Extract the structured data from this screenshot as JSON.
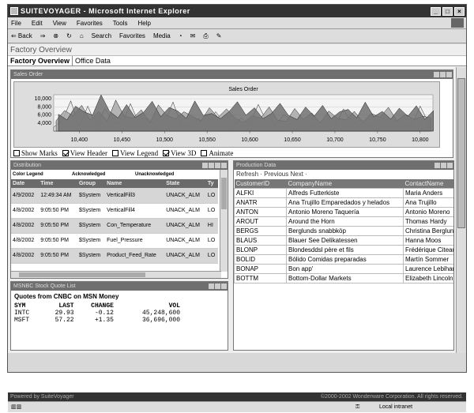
{
  "window": {
    "title": "SUITEVOYAGER - Microsoft Internet Explorer"
  },
  "menu": [
    "File",
    "Edit",
    "View",
    "Favorites",
    "Tools",
    "Help"
  ],
  "toolbar": {
    "back": "⇐ Back",
    "search": "Search",
    "favorites": "Favorites",
    "media": "Media"
  },
  "app": {
    "title": "Factory Overview",
    "tabs": [
      "Factory Overview",
      "Office Data"
    ]
  },
  "sales": {
    "panel_title": "Sales Order",
    "options": [
      {
        "label": "Show Marks",
        "checked": false
      },
      {
        "label": "View Header",
        "checked": true
      },
      {
        "label": "View Legend",
        "checked": false
      },
      {
        "label": "View 3D",
        "checked": true
      },
      {
        "label": "Animate",
        "checked": false
      }
    ]
  },
  "chart_data": {
    "type": "area",
    "title": "Sales Order",
    "xlabel": "",
    "ylabel": "",
    "xlim": [
      10370,
      10815
    ],
    "ylim": [
      2000,
      11000
    ],
    "x_ticks": [
      "10,400",
      "10,450",
      "10,500",
      "10,550",
      "10,600",
      "10,650",
      "10,700",
      "10,750",
      "10,800"
    ],
    "y_ticks": [
      "10,000",
      "8,000",
      "6,000",
      "4,000"
    ],
    "x": [
      10370,
      10380,
      10390,
      10400,
      10410,
      10420,
      10430,
      10440,
      10450,
      10460,
      10470,
      10480,
      10490,
      10500,
      10510,
      10520,
      10530,
      10540,
      10550,
      10560,
      10570,
      10580,
      10590,
      10600,
      10610,
      10620,
      10630,
      10640,
      10650,
      10660,
      10670,
      10680,
      10690,
      10700,
      10710,
      10720,
      10730,
      10740,
      10750,
      10760,
      10770,
      10780,
      10790,
      10800,
      10810
    ],
    "series": [
      {
        "values": [
          3000,
          4500,
          9500,
          3200,
          8200,
          3100,
          7600,
          4200,
          3600,
          8800,
          3900,
          5200,
          3100,
          4100,
          9200,
          3300,
          3500,
          5100,
          3200,
          6800,
          4000,
          3100,
          5300,
          3500,
          8600,
          4300,
          3200,
          6100,
          4500,
          3000,
          3300,
          3800,
          4400,
          3100,
          7500,
          3600,
          4800,
          3200,
          3900,
          3400,
          4700,
          3600,
          3300,
          8200,
          3900
        ]
      },
      {
        "values": [
          4000,
          6500,
          5200,
          7800,
          4100,
          6300,
          3900,
          9100,
          5100,
          4600,
          6700,
          3400,
          7900,
          5300,
          4400,
          6200,
          5100,
          3900,
          7200,
          4800,
          6900,
          4700,
          3500,
          5200,
          4600,
          7400,
          4100,
          3800,
          7000,
          4300,
          5900,
          3500,
          6400,
          4600,
          4200,
          6300,
          3700,
          5800,
          4800,
          7300,
          4000,
          5600,
          4300,
          5100,
          4700
        ]
      },
      {
        "values": [
          5000,
          3600,
          7000,
          5600,
          4800,
          9800,
          5700,
          4100,
          7400,
          4200,
          5500,
          8200,
          4400,
          6700,
          5800,
          4000,
          8300,
          4700,
          5200,
          3900,
          5600,
          8100,
          4800,
          6600,
          3900,
          5200,
          7700,
          4700,
          3700,
          6800,
          4500,
          7200,
          3900,
          5600,
          6200,
          4100,
          8000,
          4400,
          5700,
          3800,
          6500,
          4500,
          7100,
          3700,
          5900
        ]
      }
    ]
  },
  "distribution": {
    "panel_title": "Distribution",
    "legend": [
      "Color Legend",
      "Acknowledged",
      "Unacknowledged"
    ],
    "columns": [
      "Date",
      "Time",
      "Group",
      "Name",
      "State",
      "Ty"
    ],
    "rows": [
      [
        "4/9/2002",
        "12:49:34 AM",
        "$System",
        "VerticalFill3",
        "UNACK_ALM",
        "LO"
      ],
      [
        "4/8/2002",
        "9:05:50 PM",
        "$System",
        "VerticalFill4",
        "UNACK_ALM",
        "LO"
      ],
      [
        "4/8/2002",
        "9:05:50 PM",
        "$System",
        "Con_Temperature",
        "UNACK_ALM",
        "HI"
      ],
      [
        "4/8/2002",
        "9:05:50 PM",
        "$System",
        "Fuel_Pressure",
        "UNACK_ALM",
        "LO"
      ],
      [
        "4/8/2002",
        "9:05:50 PM",
        "$System",
        "Product_Feed_Rate",
        "UNACK_ALM",
        "LO"
      ]
    ]
  },
  "stock": {
    "panel_title": "MSNBC Stock Quote List",
    "heading": "Quotes from CNBC on MSN Money",
    "columns": [
      "SYM",
      "LAST",
      "CHANGE",
      "VOL"
    ],
    "rows": [
      [
        "INTC",
        "29.93",
        "-0.12",
        "45,248,600"
      ],
      [
        "MSFT",
        "57.22",
        "+1.35",
        "36,696,000"
      ]
    ]
  },
  "production": {
    "panel_title": "Production Data",
    "nav": {
      "refresh": "Refresh",
      "previous": "Previous",
      "next": "Next"
    },
    "columns": [
      "CustomerID",
      "CompanyName",
      "ContactName"
    ],
    "rows": [
      [
        "ALFKI",
        "Alfreds Futterkiste",
        "Maria Anders"
      ],
      [
        "ANATR",
        "Ana Trujillo Emparedados y helados",
        "Ana Trujillo"
      ],
      [
        "ANTON",
        "Antonio Moreno Taquería",
        "Antonio Moreno"
      ],
      [
        "AROUT",
        "Around the Horn",
        "Thomas Hardy"
      ],
      [
        "BERGS",
        "Berglunds snabbköp",
        "Christina Berglund"
      ],
      [
        "BLAUS",
        "Blauer See Delikatessen",
        "Hanna Moos"
      ],
      [
        "BLONP",
        "Blondesddsl père et fils",
        "Frédérique Citeaux"
      ],
      [
        "BOLID",
        "Bólido Comidas preparadas",
        "Martín Sommer"
      ],
      [
        "BONAP",
        "Bon app'",
        "Laurence Lebihan"
      ],
      [
        "BOTTM",
        "Bottom-Dollar Markets",
        "Elizabeth Lincoln"
      ]
    ]
  },
  "footer": {
    "left": "Powered by SuiteVoyager",
    "right": "©2000-2002 Wonderware Corporation. All rights reserved."
  },
  "ie_status": {
    "zone": "Local intranet"
  }
}
